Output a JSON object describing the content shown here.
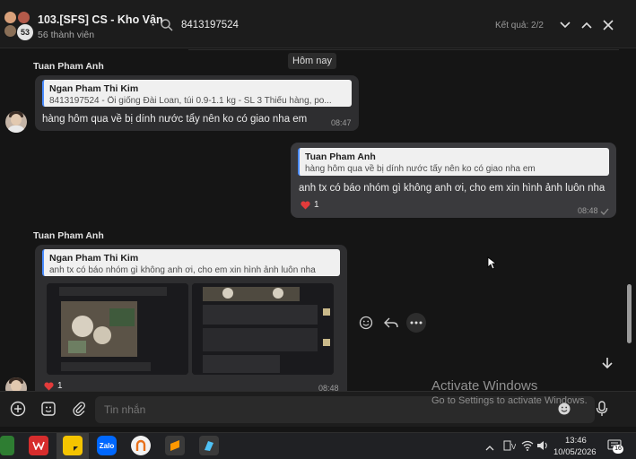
{
  "header": {
    "group_title": "103.[SFS] CS - Kho Vận",
    "members": "56 thành viên",
    "avatar_count": "53",
    "search_value": "8413197524",
    "result_count": "Kết quả: 2/2"
  },
  "chat": {
    "date_chip": "Hôm nay",
    "messages": [
      {
        "sender": "Tuan Pham Anh",
        "quote_name": "Ngan Pham Thi Kim",
        "quote_text": "8413197524 - Ổi giống Đài Loan, túi 0.9-1.1 kg - SL 3 Thiếu hàng, po...",
        "text": "hàng hôm qua về bị dính nước tẩy nên ko có giao nha em",
        "time": "08:47"
      },
      {
        "sender": "",
        "quote_name": "Tuan Pham Anh",
        "quote_text": "hàng hôm qua về bị dính nước tẩy nên ko có giao nha em",
        "text": "anh tx có báo nhóm gì không anh ơi, cho em xin hình ảnh luôn nha",
        "time": "08:48",
        "reaction_count": "1"
      },
      {
        "sender": "Tuan Pham Anh",
        "quote_name": "Ngan Pham Thi Kim",
        "quote_text": "anh tx có báo nhóm gì không anh ơi, cho em xin hình ảnh luôn nha",
        "reaction_count": "1",
        "time": "08:48"
      }
    ]
  },
  "input": {
    "placeholder": "Tin nhắn"
  },
  "watermark": {
    "title": "Activate Windows",
    "subtitle": "Go to Settings to activate Windows."
  },
  "taskbar": {
    "apps": [
      "wps-office",
      "sticky-notes",
      "zalo",
      "ultraviewer",
      "sublime-text",
      "app-icon"
    ],
    "tray_time": "13:46",
    "tray_date": "10/05/2026",
    "notif_count": "16"
  },
  "colors": {
    "background": "#151515",
    "bubble_other": "#2e2e30",
    "bubble_me": "#3a3a3d",
    "quote_bg": "#f0f0f0",
    "accent": "#4a8cff"
  }
}
